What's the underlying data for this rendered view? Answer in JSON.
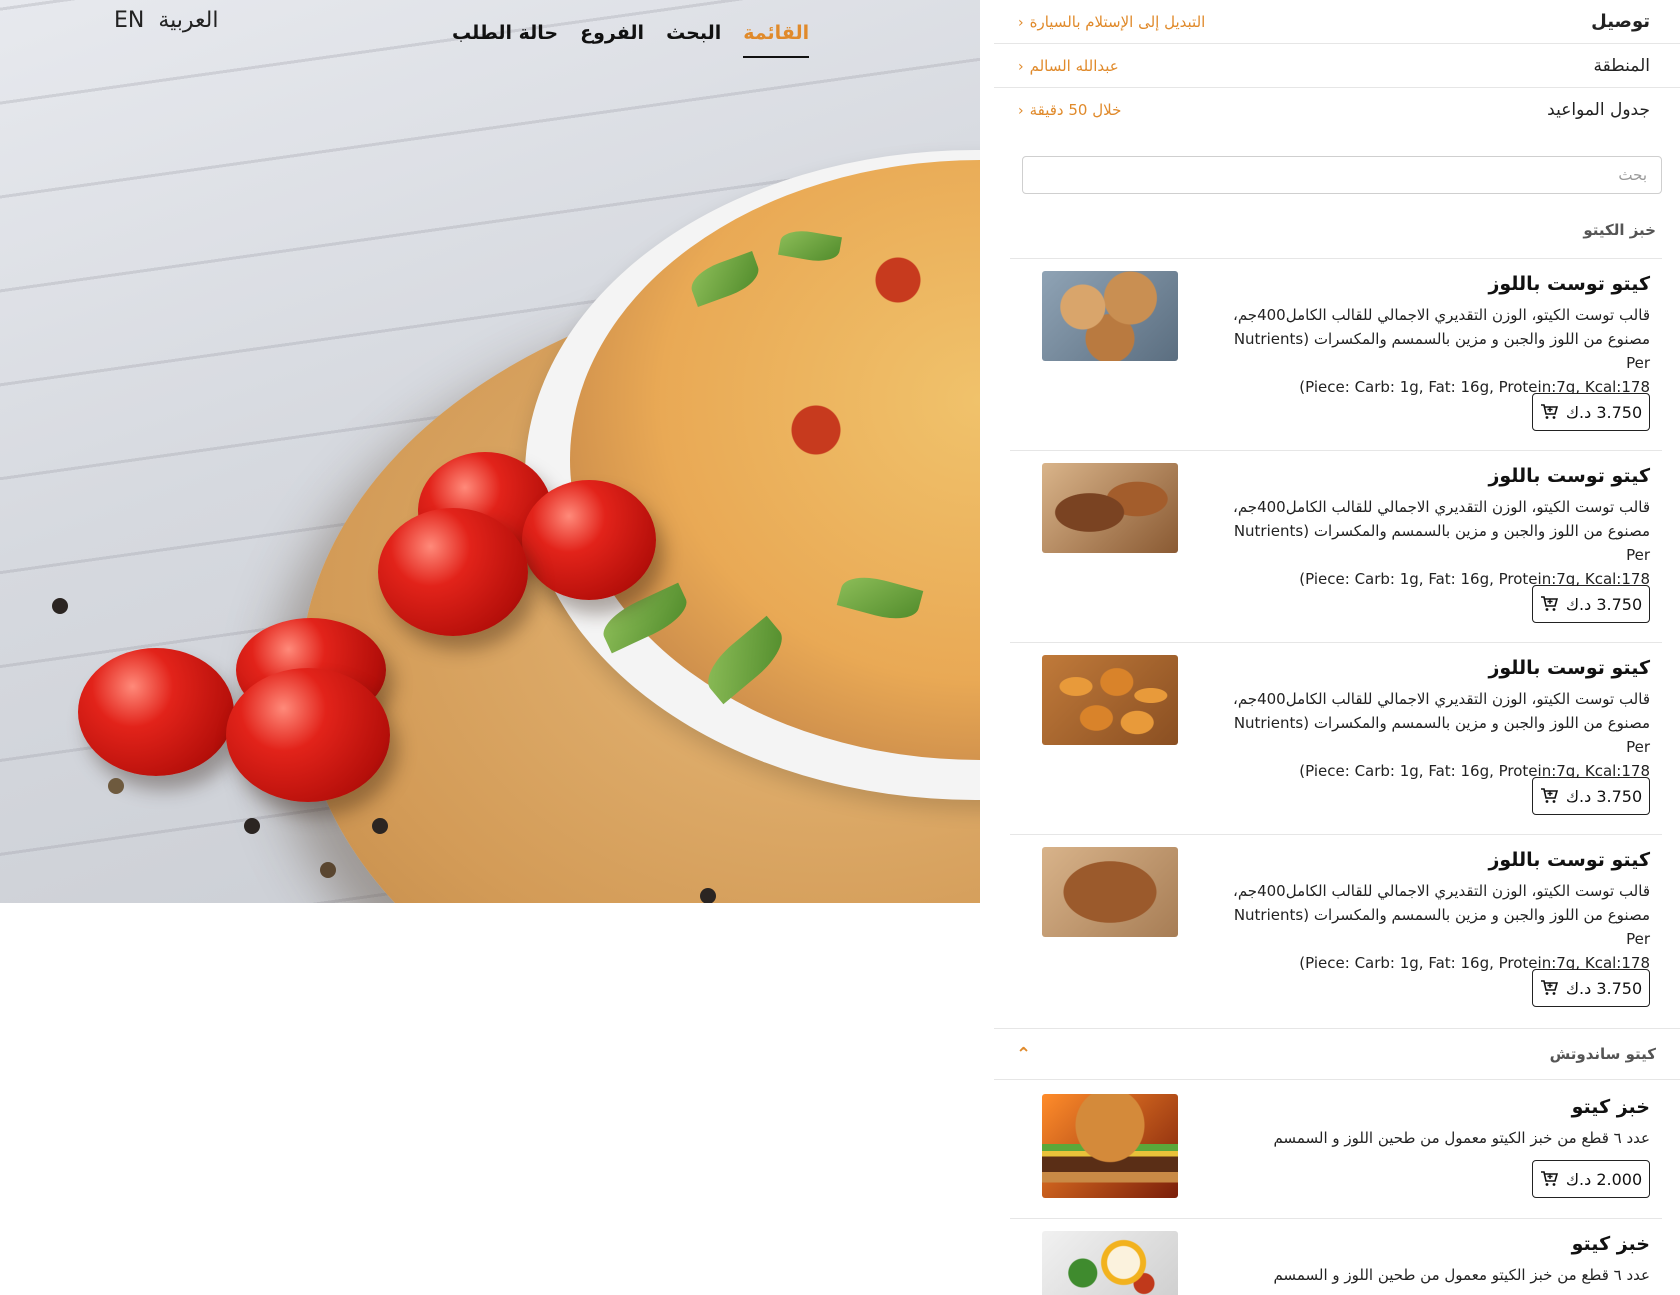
{
  "header": {
    "lang_en": "EN",
    "lang_ar": "العربية",
    "nav": [
      {
        "label": "القائمة",
        "active": true
      },
      {
        "label": "البحث",
        "active": false
      },
      {
        "label": "الفروع",
        "active": false
      },
      {
        "label": "حالة الطلب",
        "active": false
      }
    ]
  },
  "panel": {
    "delivery_label": "توصيل",
    "switch_link": "التبديل إلى الإستلام بالسيارة",
    "area_label": "المنطقة",
    "area_value": "عبدالله السالم",
    "schedule_label": "جدول المواعيد",
    "schedule_value": "خلال 50 دقيقة",
    "search_placeholder": "بحث",
    "sections": [
      {
        "title": "خبز الكيتو",
        "products": [
          {
            "name": "كيتو توست باللوز",
            "desc_line1": "قالب توست الكيتو، الوزن التقديري الاجمالي للقالب الكامل400جم،",
            "desc_line2": "مصنوع من اللوز والجبن و مزين بالسمسم والمكسرات (Nutrients Per",
            "desc_line3": "Piece: Carb: 1g, Fat: 16g, Protein:7g, Kcal:178)",
            "price": "3.750 د.ك",
            "image": "bread-basket-photo"
          },
          {
            "name": "كيتو توست باللوز",
            "desc_line1": "قالب توست الكيتو، الوزن التقديري الاجمالي للقالب الكامل400جم،",
            "desc_line2": "مصنوع من اللوز والجبن و مزين بالسمسم والمكسرات (Nutrients Per",
            "desc_line3": "Piece: Carb: 1g, Fat: 16g, Protein:7g, Kcal:178)",
            "price": "3.750 د.ك",
            "image": "bread-loaves-photo"
          },
          {
            "name": "كيتو توست باللوز",
            "desc_line1": "قالب توست الكيتو، الوزن التقديري الاجمالي للقالب الكامل400جم،",
            "desc_line2": "مصنوع من اللوز والجبن و مزين بالسمسم والمكسرات (Nutrients Per",
            "desc_line3": "Piece: Carb: 1g, Fat: 16g, Protein:7g, Kcal:178)",
            "price": "3.750 د.ك",
            "image": "croissants-photo"
          },
          {
            "name": "كيتو توست باللوز",
            "desc_line1": "قالب توست الكيتو، الوزن التقديري الاجمالي للقالب الكامل400جم،",
            "desc_line2": "مصنوع من اللوز والجبن و مزين بالسمسم والمكسرات (Nutrients Per",
            "desc_line3": "Piece: Carb: 1g, Fat: 16g, Protein:7g, Kcal:178)",
            "price": "3.750 د.ك",
            "image": "baguette-photo"
          }
        ]
      },
      {
        "title": "كيتو ساندوتش",
        "products": [
          {
            "name": "خبز كيتو",
            "desc_line1": "عدد ٦ قطع من خبز الكيتو معمول من طحين اللوز و السمسم",
            "price": "2.000 د.ك",
            "image": "burger-photo"
          },
          {
            "name": "خبز كيتو",
            "desc_line1": "عدد ٦ قطع من خبز الكيتو معمول من طحين اللوز و السمسم",
            "price": "",
            "image": "egg-salad-photo"
          }
        ]
      }
    ]
  },
  "colors": {
    "accent": "#e08a2b",
    "text": "#222222",
    "divider": "#e6e6e6"
  }
}
